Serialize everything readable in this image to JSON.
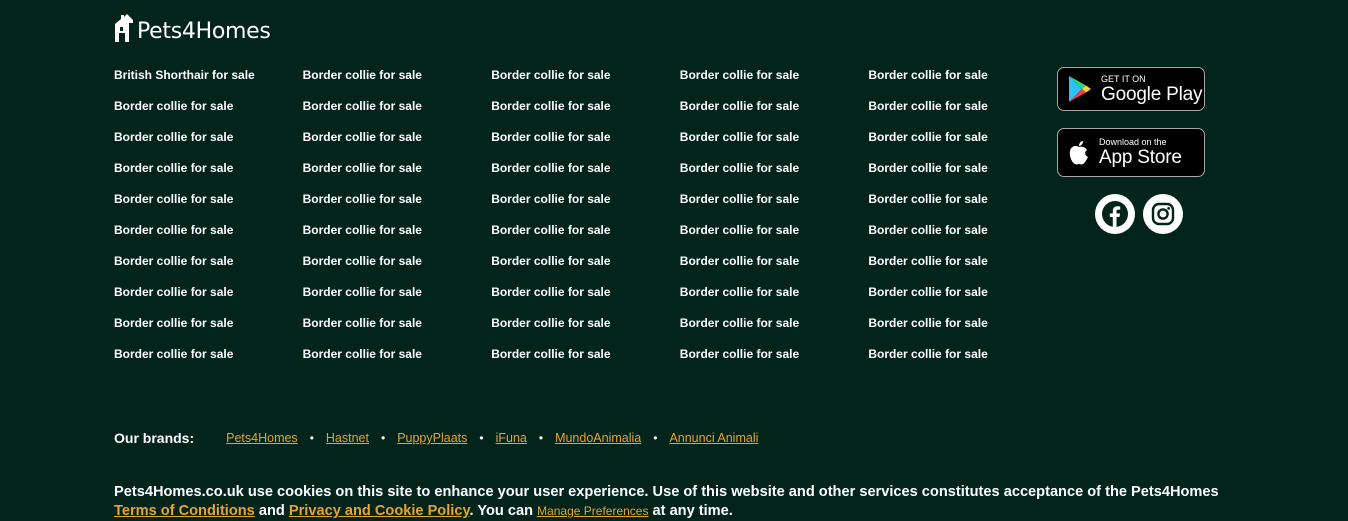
{
  "logo": {
    "text": "Pets4Homes"
  },
  "links": {
    "rows": [
      [
        "British Shorthair for sale",
        "Border collie for sale",
        "Border collie for sale",
        "Border collie for sale",
        "Border collie for sale"
      ],
      [
        "Border collie for sale",
        "Border collie for sale",
        "Border collie for sale",
        "Border collie for sale",
        "Border collie for sale"
      ],
      [
        "Border collie for sale",
        "Border collie for sale",
        "Border collie for sale",
        "Border collie for sale",
        "Border collie for sale"
      ],
      [
        "Border collie for sale",
        "Border collie for sale",
        "Border collie for sale",
        "Border collie for sale",
        "Border collie for sale"
      ],
      [
        "Border collie for sale",
        "Border collie for sale",
        "Border collie for sale",
        "Border collie for sale",
        "Border collie for sale"
      ],
      [
        "Border collie for sale",
        "Border collie for sale",
        "Border collie for sale",
        "Border collie for sale",
        "Border collie for sale"
      ],
      [
        "Border collie for sale",
        "Border collie for sale",
        "Border collie for sale",
        "Border collie for sale",
        "Border collie for sale"
      ],
      [
        "Border collie for sale",
        "Border collie for sale",
        "Border collie for sale",
        "Border collie for sale",
        "Border collie for sale"
      ],
      [
        "Border collie for sale",
        "Border collie for sale",
        "Border collie for sale",
        "Border collie for sale",
        "Border collie for sale"
      ],
      [
        "Border collie for sale",
        "Border collie for sale",
        "Border collie for sale",
        "Border collie for sale",
        "Border collie for sale"
      ]
    ]
  },
  "apps": {
    "google_play": {
      "small": "GET IT ON",
      "big": "Google Play"
    },
    "app_store": {
      "small": "Download on the",
      "big": "App Store"
    }
  },
  "social": {
    "icons": [
      "facebook-icon",
      "instagram-icon"
    ],
    "color": "#03241a"
  },
  "brands": {
    "label": "Our brands:",
    "items": [
      "Pets4Homes",
      "Hastnet",
      "PuppyPlaats",
      "iFuna",
      "MundoAnimalia",
      "Annunci Animali"
    ],
    "bullet": "•"
  },
  "cookie": {
    "text1": "Pets4Homes.co.uk use cookies on this site to enhance your user experience. Use of this website and other services constitutes acceptance of the Pets4Homes ",
    "terms_link": "Terms of Conditions",
    "text2": " and ",
    "privacy_link": "Privacy and Cookie Policy",
    "text3": ". You can ",
    "manage_link": "Manage Preferences",
    "text4": " at any time."
  },
  "colors": {
    "background": "#03241a",
    "accent": "#e8a42e",
    "text": "#ffffff"
  }
}
